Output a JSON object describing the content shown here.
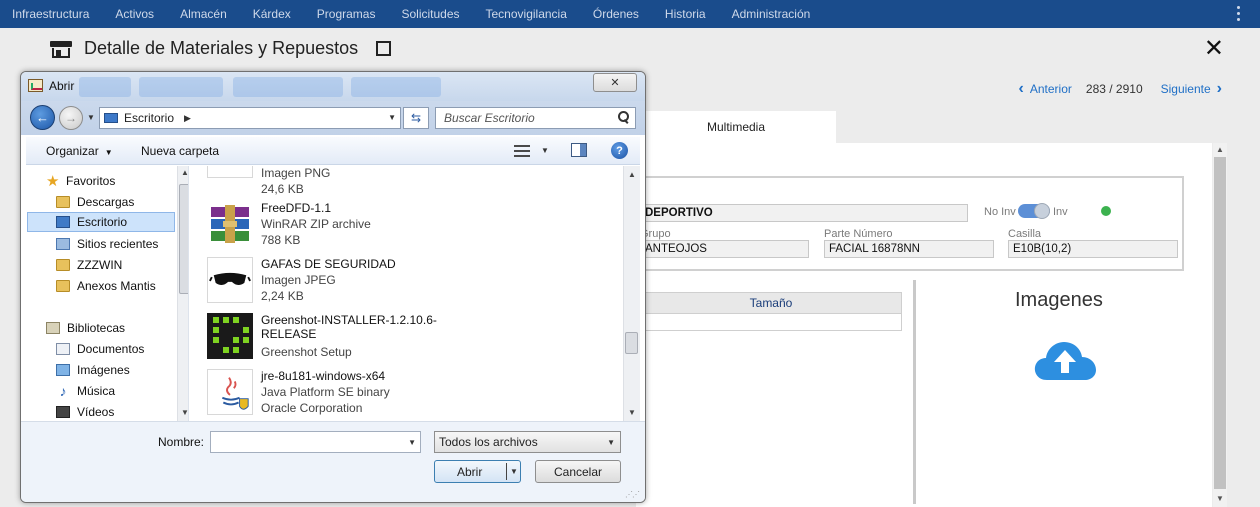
{
  "topnav": {
    "items": [
      "Infraestructura",
      "Activos",
      "Almacén",
      "Kárdex",
      "Programas",
      "Solicitudes",
      "Tecnovigilancia",
      "Órdenes",
      "Historia",
      "Administración"
    ]
  },
  "header": {
    "title": "Detalle de Materiales y Repuestos"
  },
  "pager": {
    "prev_label": "Anterior",
    "count": "283 / 2910",
    "next_label": "Siguiente"
  },
  "tabs": {
    "multimedia": "Multimedia"
  },
  "form": {
    "name_value": "DEPORTIVO",
    "toggle_off_label": "No Inv",
    "toggle_on_label": "Inv",
    "group_label": "Grupo",
    "group_value": "ANTEOJOS",
    "part_label": "Parte Número",
    "part_value": "FACIAL 16878NN",
    "slot_label": "Casilla",
    "slot_value": "E10B(10,2)",
    "status_color": "#3cb24f"
  },
  "files_table": {
    "header_size": "Tamaño"
  },
  "images": {
    "title": "Imagenes",
    "upload_icon": "cloud-upload-icon",
    "accent": "#2d8fe0"
  },
  "dialog": {
    "title": "Abrir",
    "close_glyph": "✕",
    "address": "Escritorio",
    "search_placeholder": "Buscar Escritorio",
    "toolbar": {
      "organize": "Organizar",
      "new_folder": "Nueva carpeta"
    },
    "nav": {
      "favorites": "Favoritos",
      "items_fav": [
        "Descargas",
        "Escritorio",
        "Sitios recientes",
        "ZZZWIN",
        "Anexos Mantis"
      ],
      "libraries": "Bibliotecas",
      "items_lib": [
        "Documentos",
        "Imágenes",
        "Música",
        "Vídeos"
      ]
    },
    "files": [
      {
        "name": "",
        "type": "Imagen PNG",
        "size": "24,6 KB"
      },
      {
        "name": "FreeDFD-1.1",
        "type": "WinRAR ZIP archive",
        "size": "788 KB"
      },
      {
        "name": "GAFAS DE SEGURIDAD",
        "type": "Imagen JPEG",
        "size": "2,24 KB"
      },
      {
        "name": "Greenshot-INSTALLER-1.2.10.6-RELEASE",
        "type": "Greenshot Setup",
        "size": ""
      },
      {
        "name": "jre-8u181-windows-x64",
        "type": "Java Platform SE binary",
        "size": "Oracle Corporation"
      }
    ],
    "name_label": "Nombre:",
    "name_value": "",
    "file_type": "Todos los archivos",
    "open_label": "Abrir",
    "cancel_label": "Cancelar"
  }
}
